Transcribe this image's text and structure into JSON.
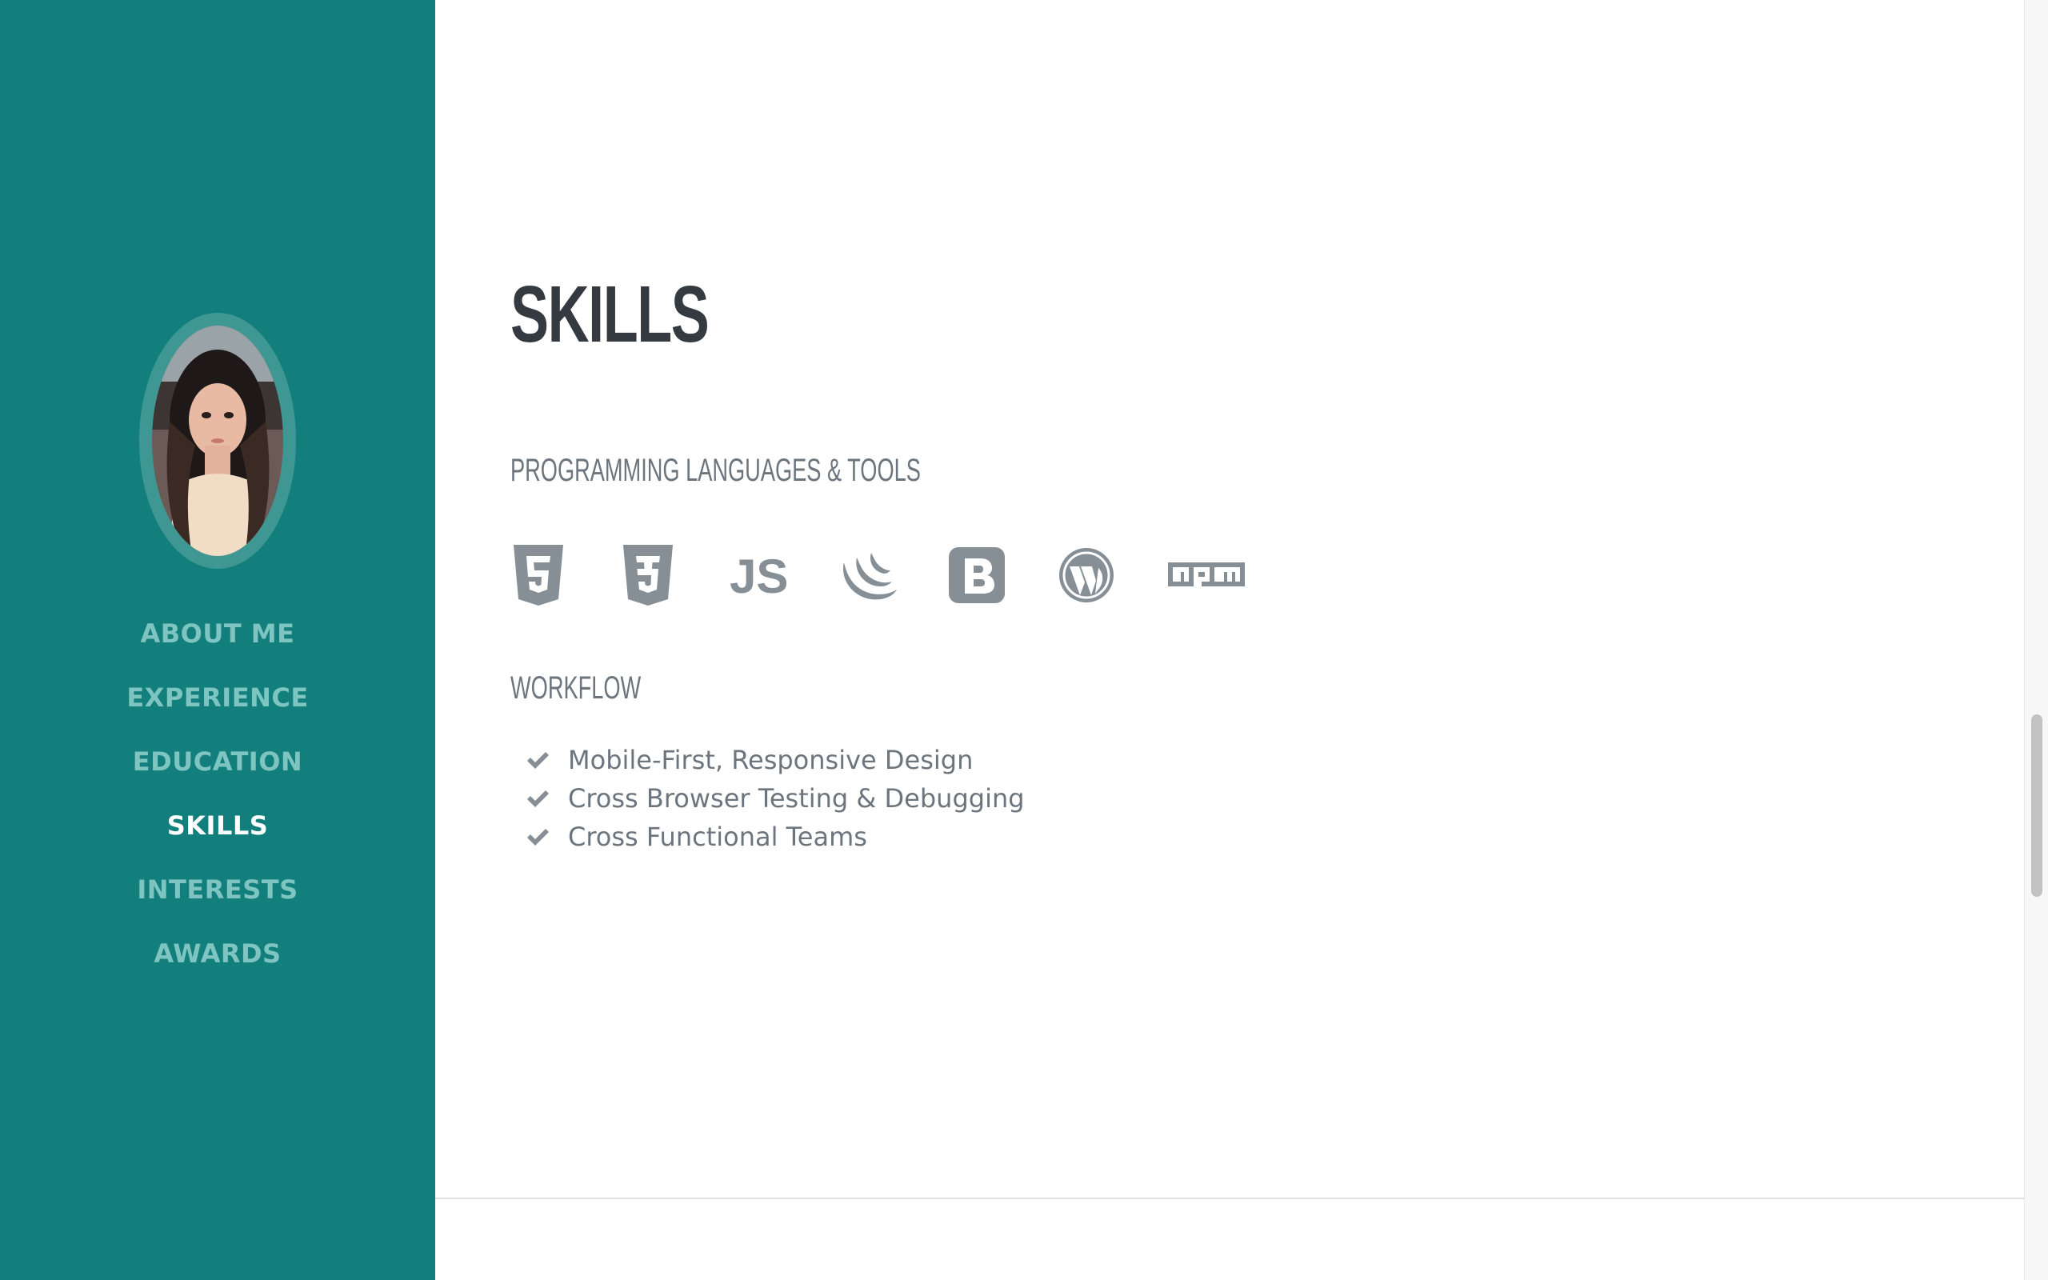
{
  "sidebar": {
    "avatar_alt": "profile photo",
    "nav": [
      {
        "label": "ABOUT ME",
        "active": false
      },
      {
        "label": "EXPERIENCE",
        "active": false
      },
      {
        "label": "EDUCATION",
        "active": false
      },
      {
        "label": "SKILLS",
        "active": true
      },
      {
        "label": "INTERESTS",
        "active": false
      },
      {
        "label": "AWARDS",
        "active": false
      }
    ],
    "color": "#127f7c"
  },
  "main": {
    "title": "SKILLS",
    "programming": {
      "heading": "PROGRAMMING LANGUAGES & TOOLS",
      "icons": [
        "html5-icon",
        "css3-icon",
        "js-icon",
        "jquery-icon",
        "bootstrap-icon",
        "wordpress-icon",
        "npm-icon"
      ]
    },
    "workflow": {
      "heading": "WORKFLOW",
      "items": [
        "Mobile-First, Responsive Design",
        "Cross Browser Testing & Debugging",
        "Cross Functional Teams"
      ]
    }
  }
}
